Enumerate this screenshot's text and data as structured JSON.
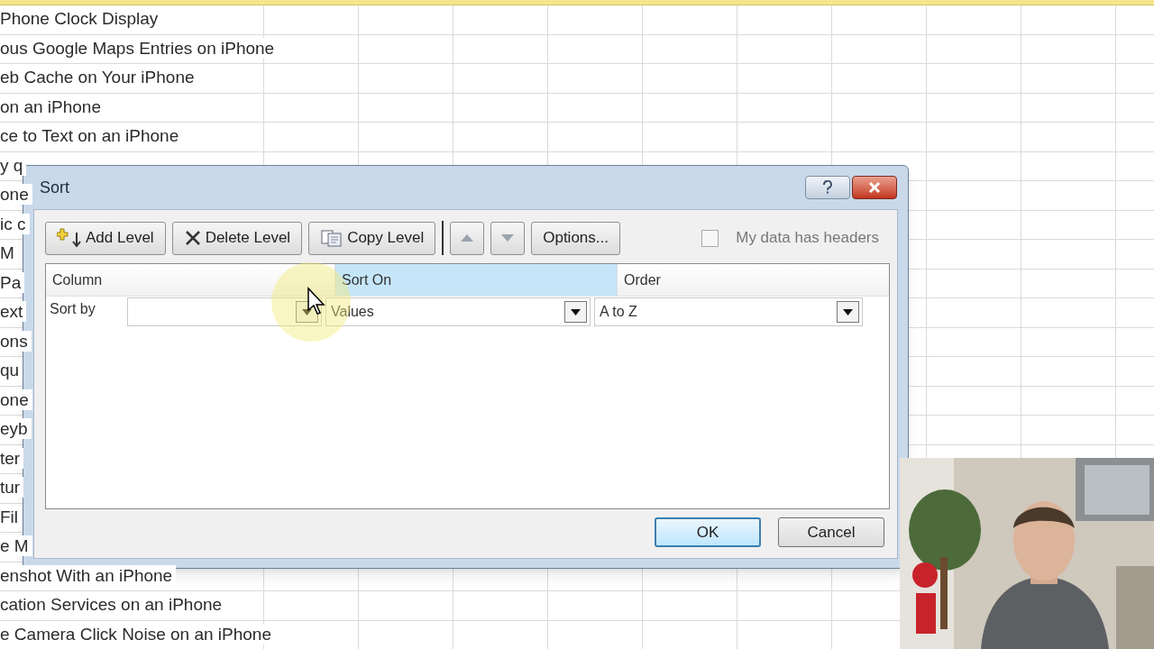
{
  "sheet": {
    "rows": [
      "Phone Clock Display",
      "ous Google Maps Entries on iPhone",
      "eb Cache on Your iPhone",
      "on an iPhone",
      "ce to Text on an iPhone",
      "y q",
      "one",
      "ic c",
      "M",
      "Pa",
      "ext",
      "ons",
      "qu",
      "one",
      "eyb",
      "ter",
      "tur",
      "Fil",
      "e M",
      "enshot With an iPhone",
      "cation Services on an iPhone",
      "e Camera Click Noise on an iPhone"
    ]
  },
  "dialog": {
    "title": "Sort",
    "toolbar": [
      {
        "label": "Add Level",
        "kind": "add"
      },
      {
        "label": "Delete Level",
        "kind": "delete"
      },
      {
        "label": "Copy Level",
        "kind": "copy"
      },
      {
        "kind": "up"
      },
      {
        "kind": "down"
      },
      {
        "label": "Options...",
        "kind": "text"
      }
    ],
    "headers_checkbox": {
      "label": "My data has headers",
      "checked": false
    },
    "columns": [
      {
        "label": "Column",
        "selected": false
      },
      {
        "label": "Sort On",
        "selected": true
      },
      {
        "label": "Order",
        "selected": false
      }
    ],
    "levels": [
      {
        "label": "Sort by",
        "sort_on": "Values",
        "order": "A to Z"
      }
    ],
    "buttons": [
      {
        "label": "OK",
        "default": true
      },
      {
        "label": "Cancel",
        "default": false
      }
    ]
  }
}
